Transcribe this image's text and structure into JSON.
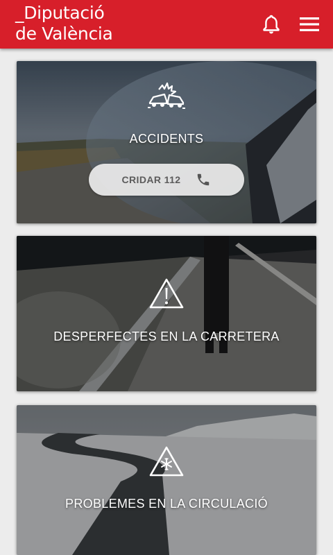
{
  "header": {
    "logo_line1": "_Diputació",
    "logo_line2": "de València",
    "notifications_icon": "bell-icon",
    "menu_icon": "hamburger-menu-icon",
    "background_color": "#d71f2a"
  },
  "cards": [
    {
      "title": "ACCIDENTS",
      "icon": "car-crash-icon",
      "call_button": {
        "label": "CRIDAR 112",
        "icon": "phone-icon"
      }
    },
    {
      "title": "DESPERFECTES EN LA CARRETERA",
      "icon": "warning-triangle-icon"
    },
    {
      "title": "PROBLEMES EN LA CIRCULACIÓ",
      "icon": "snowflake-triangle-icon"
    }
  ]
}
